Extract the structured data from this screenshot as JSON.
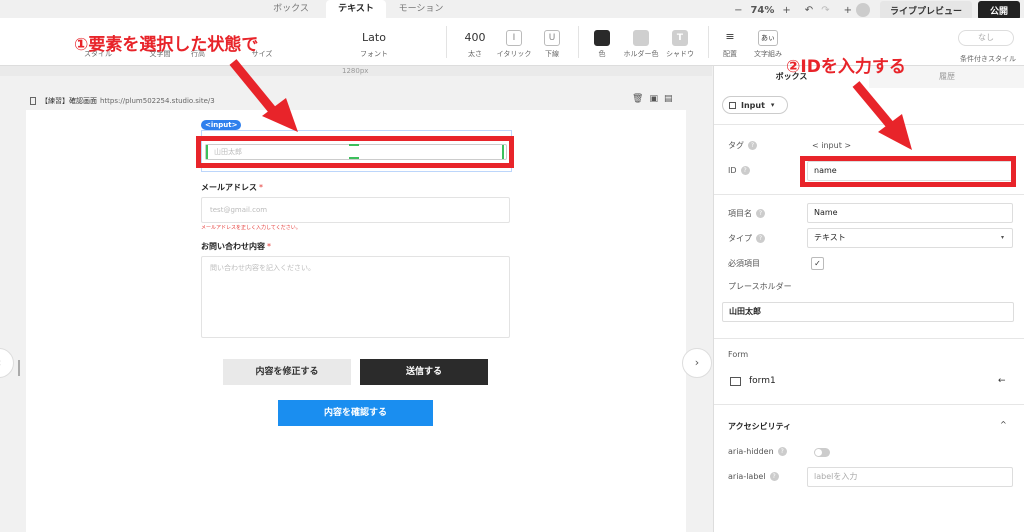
{
  "top_tabs": [
    {
      "label": "ボックス"
    },
    {
      "label": "テキスト"
    },
    {
      "label": "モーション"
    }
  ],
  "top_right": {
    "minus": "−",
    "zoom": "74%",
    "plus": "+",
    "undo": "↶",
    "redo": "↷",
    "live_preview": "ライブプレビュー",
    "publish": "公開"
  },
  "toolbar": {
    "style_label": "スタイル",
    "spacing_label": "文字間",
    "line_label": "行高",
    "size_label": "サイズ",
    "font_value": "Lato",
    "font_label": "フォント",
    "weight_value": "400",
    "weight_label": "太さ",
    "italic_glyph": "I",
    "italic_label": "イタリック",
    "underline_glyph": "U",
    "underline_label": "下線",
    "color_label": "色",
    "holder_color_label": "ホルダー色",
    "shadow_glyph": "T",
    "shadow_label": "シャドウ",
    "align_label": "配置",
    "kumi_glyph": "あぃ",
    "kumi_label": "文字組み",
    "none_btn": "なし",
    "conditional_label": "条件付きスタイル"
  },
  "canvas": {
    "ruler_label": "1280px",
    "page_title": "【練習】確認画面",
    "page_url": "https://plum502254.studio.site/3",
    "input_chip": "<input>",
    "name_placeholder": "山田太郎",
    "email_label": "メールアドレス",
    "required_mark": "*",
    "email_placeholder": "test@gmail.com",
    "email_error": "メールアドレスを正しく入力してください。",
    "inquiry_label": "お問い合わせ内容",
    "inquiry_placeholder": "問い合わせ内容を記入ください。",
    "fix_button": "内容を修正する",
    "send_button": "送信する",
    "confirm_button": "内容を確認する",
    "nav_left": "‹",
    "nav_right": "›"
  },
  "panel": {
    "tabs": [
      {
        "label": "ボックス"
      },
      {
        "label": "履歴"
      }
    ],
    "element_type": "Input",
    "tag_label": "タグ",
    "tag_value": "< input >",
    "id_label": "ID",
    "id_value": "name",
    "item_name_label": "項目名",
    "item_name_value": "Name",
    "type_label": "タイプ",
    "type_value": "テキスト",
    "required_label": "必須項目",
    "required_checked": "✓",
    "placeholder_label": "プレースホルダー",
    "placeholder_value": "山田太郎",
    "form_section": "Form",
    "form_name": "form1",
    "form_arrow": "←",
    "accessibility_title": "アクセシビリティ",
    "aria_hidden_label": "aria-hidden",
    "aria_label_label": "aria-label",
    "aria_label_placeholder": "labelを入力",
    "q_mark": "?",
    "chevron_down": "▾",
    "chevron_up": "^"
  },
  "annotations": {
    "step1": "①要素を選択した状態で",
    "step2": "②IDを入力する",
    "color": "#e8242a"
  },
  "colors": {
    "accent_blue": "#1a8ef0",
    "dark_button": "#2b2b2b",
    "error_red": "#e53935"
  }
}
